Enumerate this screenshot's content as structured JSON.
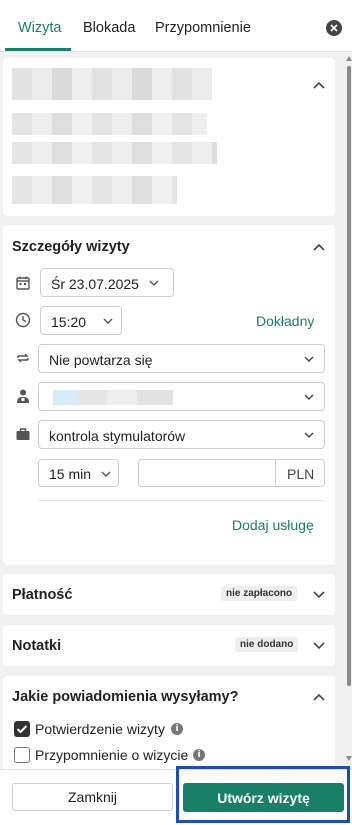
{
  "tabs": {
    "visit": "Wizyta",
    "block": "Blokada",
    "reminder": "Przypomnienie"
  },
  "details": {
    "title": "Szczegóły wizyty",
    "date": "Śr 23.07.2025",
    "time": "15:20",
    "exact_link": "Dokładny",
    "repeat": "Nie powtarza się",
    "service": "kontrola stymulatorów",
    "duration": "15 min",
    "price_value": "",
    "currency": "PLN",
    "add_service_link": "Dodaj usługę"
  },
  "payment": {
    "title": "Płatność",
    "badge": "nie zapłacono"
  },
  "notes": {
    "title": "Notatki",
    "badge": "nie dodano"
  },
  "notifications": {
    "title": "Jakie powiadomienia wysyłamy?",
    "items": [
      {
        "label": "Potwierdzenie wizyty",
        "checked": true
      },
      {
        "label": "Przypomnienie o wizycie",
        "checked": false
      }
    ]
  },
  "footer": {
    "close_label": "Zamknij",
    "create_label": "Utwórz wizytę"
  },
  "colors": {
    "accent": "#1b7f6b",
    "primary_button": "#1a7f67",
    "highlight_border": "#1e4db7"
  },
  "icons": [
    "close-icon",
    "chevron-up-icon",
    "chevron-down-icon",
    "calendar-icon",
    "clock-icon",
    "repeat-icon",
    "doctor-icon",
    "briefcase-icon",
    "info-icon",
    "check-icon"
  ]
}
